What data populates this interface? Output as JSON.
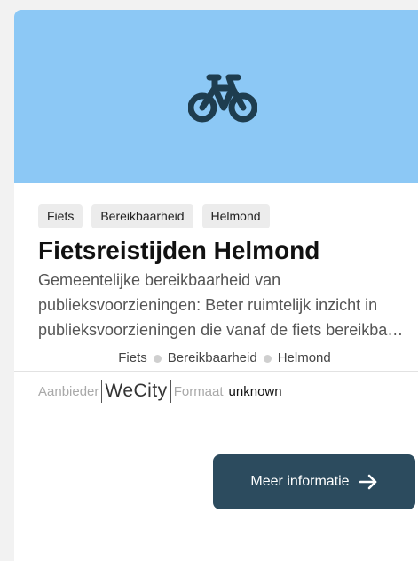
{
  "card": {
    "hero_icon": "bicycle-icon",
    "hero_color": "#8cc8f5",
    "tags": [
      "Fiets",
      "Bereikbaarheid",
      "Helmond"
    ],
    "title": "Fietsreistijden Helmond",
    "description": "Gemeentelijke bereikbaarheid van publieksvoorzieningen: Beter ruimtelijk inzicht in publieksvoorzieningen die vanaf de fiets bereikbaar zijn.",
    "keywords": [
      "Fiets",
      "Bereikbaarheid",
      "Helmond"
    ],
    "provider_label": "Aanbieder",
    "provider_value": "WeCity",
    "format_label": "Formaat",
    "format_value": "unknown",
    "button_label": "Meer informatie",
    "button_icon": "arrow-right-icon",
    "button_color": "#2c4b5e"
  }
}
